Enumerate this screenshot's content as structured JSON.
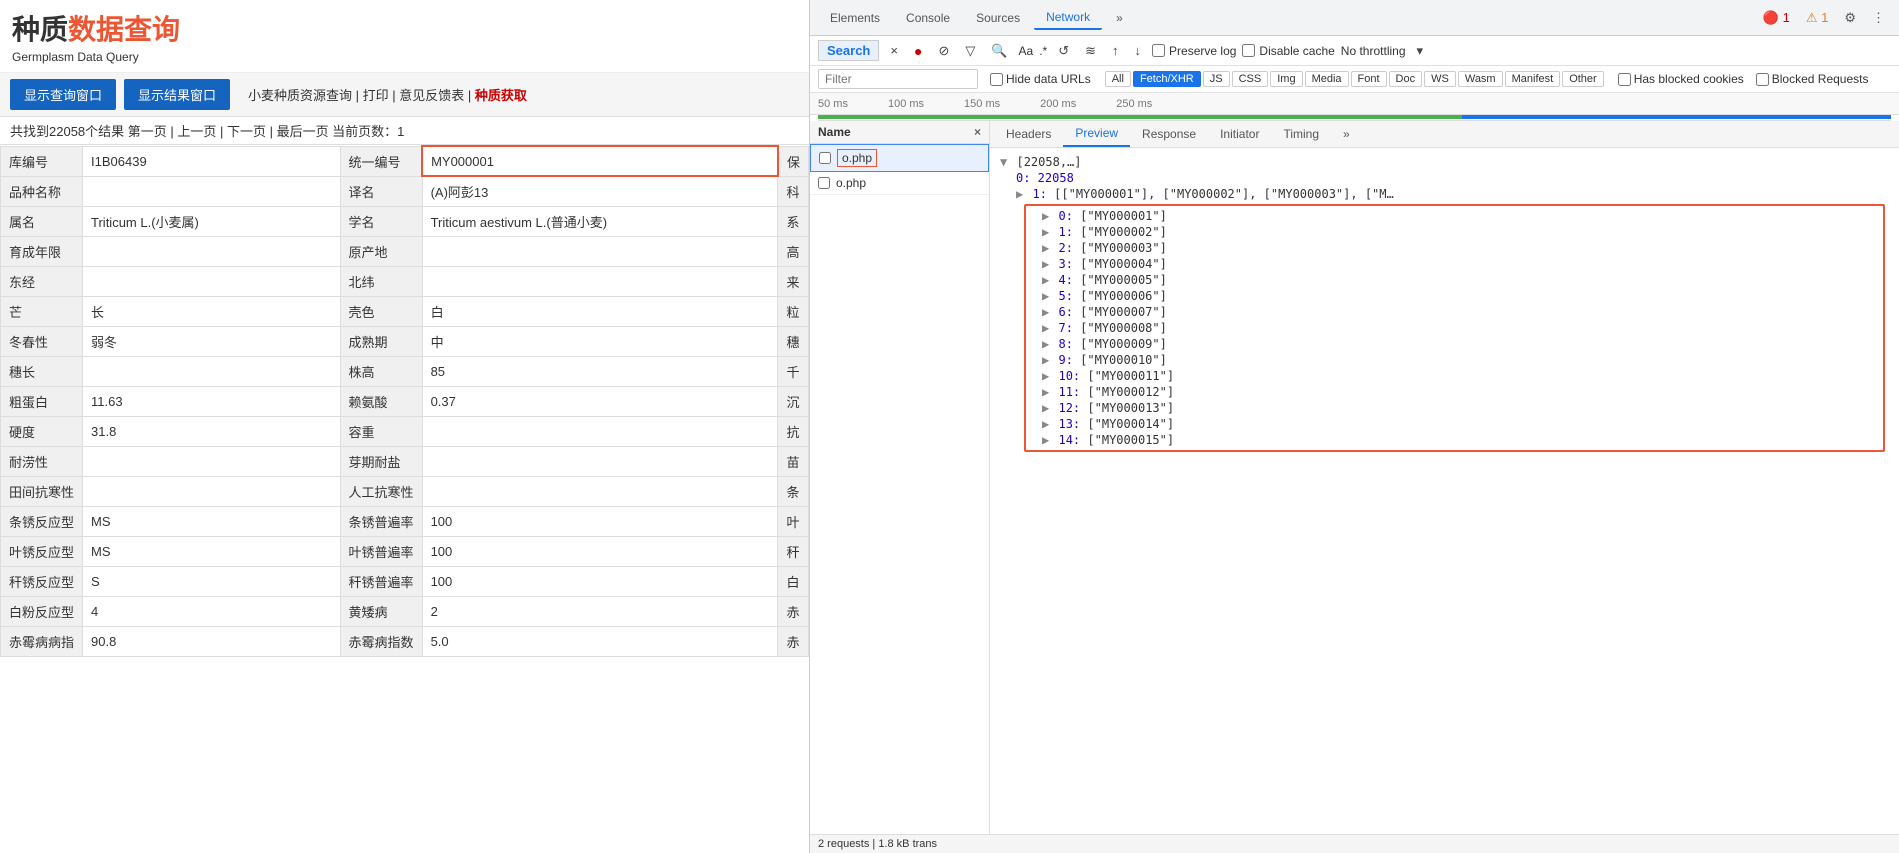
{
  "app": {
    "logo_zh1": "种质",
    "logo_zh2": "数据查询",
    "logo_subtitle": "Germplasm Data Query"
  },
  "toolbar": {
    "btn1": "显示查询窗口",
    "btn2": "显示结果窗口",
    "links_text": "小麦种质资源查询 | 打印 | 意见反馈表 |",
    "links_red": "种质获取"
  },
  "pagination": {
    "text": "共找到22058个结果  第一页 | 上一页 | 下一页 | 最后一页  当前页数：1"
  },
  "table_rows": [
    {
      "label1": "库编号",
      "val1": "I1B06439",
      "label2": "统一编号",
      "val2": "MY000001",
      "label3": "保",
      "val3": ""
    },
    {
      "label1": "品种名称",
      "val1": "",
      "label2": "译名",
      "val2": "(A)阿彭13",
      "label3": "科",
      "val3": ""
    },
    {
      "label1": "属名",
      "val1": "Triticum L.(小麦属)",
      "label2": "学名",
      "val2": "Triticum aestivum L.(普通小麦)",
      "label3": "系",
      "val3": ""
    },
    {
      "label1": "育成年限",
      "val1": "",
      "label2": "原产地",
      "val2": "",
      "label3": "高",
      "val3": ""
    },
    {
      "label1": "东经",
      "val1": "",
      "label2": "北纬",
      "val2": "",
      "label3": "来",
      "val3": ""
    },
    {
      "label1": "芒",
      "val1": "长",
      "label2": "壳色",
      "val2": "白",
      "label3": "粒",
      "val3": ""
    },
    {
      "label1": "冬春性",
      "val1": "弱冬",
      "label2": "成熟期",
      "val2": "中",
      "label3": "穗",
      "val3": ""
    },
    {
      "label1": "穗长",
      "val1": "",
      "label2": "株高",
      "val2": "85",
      "label3": "千",
      "val3": ""
    },
    {
      "label1": "粗蛋白",
      "val1": "11.63",
      "label2": "赖氨酸",
      "val2": "0.37",
      "label3": "沉",
      "val3": ""
    },
    {
      "label1": "硬度",
      "val1": "31.8",
      "label2": "容重",
      "val2": "",
      "label3": "抗",
      "val3": ""
    },
    {
      "label1": "耐涝性",
      "val1": "",
      "label2": "芽期耐盐",
      "val2": "",
      "label3": "苗",
      "val3": ""
    },
    {
      "label1": "田间抗寒性",
      "val1": "",
      "label2": "人工抗寒性",
      "val2": "",
      "label3": "条",
      "val3": ""
    },
    {
      "label1": "条锈反应型",
      "val1": "MS",
      "label2": "条锈普遍率",
      "val2": "100",
      "label3": "叶",
      "val3": ""
    },
    {
      "label1": "叶锈反应型",
      "val1": "MS",
      "label2": "叶锈普遍率",
      "val2": "100",
      "label3": "秆",
      "val3": ""
    },
    {
      "label1": "秆锈反应型",
      "val1": "S",
      "label2": "秆锈普遍率",
      "val2": "100",
      "label3": "白",
      "val3": ""
    },
    {
      "label1": "白粉反应型",
      "val1": "4",
      "label2": "黄矮病",
      "val2": "2",
      "label3": "赤",
      "val3": ""
    },
    {
      "label1": "赤霉病病指",
      "val1": "90.8",
      "label2": "赤霉病指数",
      "val2": "5.0",
      "label3": "赤",
      "val3": ""
    }
  ],
  "devtools": {
    "tabs": [
      "Elements",
      "Console",
      "Sources",
      "Network"
    ],
    "active_tab": "Network",
    "more_tabs": "»",
    "error_count": "1",
    "warn_count": "1",
    "settings_icon": "⚙",
    "more_icon": "⋮"
  },
  "network_toolbar": {
    "search_label": "Search",
    "search_close": "×",
    "record_btn": "●",
    "stop_btn": "🚫",
    "filter_btn": "▽",
    "search_icon": "🔍",
    "aa_label": "Aa",
    "dot_label": ".*",
    "refresh_icon": "↺",
    "preserve_log": "Preserve log",
    "disable_cache": "Disable cache",
    "no_throttling": "No throttling",
    "dropdown_icon": "▾",
    "wifi_icon": "📶",
    "up_icon": "↑",
    "down_icon": "↓"
  },
  "filter": {
    "placeholder": "Filter",
    "hide_data_urls": "Hide data URLs",
    "filter_types": [
      "All",
      "Fetch/XHR",
      "JS",
      "CSS",
      "Img",
      "Media",
      "Font",
      "Doc",
      "WS",
      "Wasm",
      "Manifest",
      "Other"
    ],
    "active_filter": "Fetch/XHR",
    "has_blocked": "Has blocked cookies",
    "blocked_requests": "Blocked Requests"
  },
  "timeline": {
    "marks": [
      "50 ms",
      "100 ms",
      "150 ms",
      "200 ms",
      "250 ms"
    ]
  },
  "network_list": {
    "header": "Name",
    "items": [
      {
        "name": "o.php",
        "selected": true
      },
      {
        "name": "o.php",
        "selected": false
      }
    ]
  },
  "detail_tabs": [
    "Headers",
    "Preview",
    "Response",
    "Initiator",
    "Timing",
    "»"
  ],
  "active_detail_tab": "Preview",
  "json_preview": {
    "root_label": "▼ [22058,…]",
    "item_0": "0: 22058",
    "item_1_label": "▶ 1: [[\"MY000001\"], [\"MY000002\"], [\"MY000003\"], [\"M…",
    "subitems": [
      {
        "arrow": "▶",
        "key": "0",
        "val": "[\"MY000001\"]"
      },
      {
        "arrow": "▶",
        "key": "1",
        "val": "[\"MY000002\"]"
      },
      {
        "arrow": "▶",
        "key": "2",
        "val": "[\"MY000003\"]"
      },
      {
        "arrow": "▶",
        "key": "3",
        "val": "[\"MY000004\"]"
      },
      {
        "arrow": "▶",
        "key": "4",
        "val": "[\"MY000005\"]"
      },
      {
        "arrow": "▶",
        "key": "5",
        "val": "[\"MY000006\"]"
      },
      {
        "arrow": "▶",
        "key": "6",
        "val": "[\"MY000007\"]"
      },
      {
        "arrow": "▶",
        "key": "7",
        "val": "[\"MY000008\"]"
      },
      {
        "arrow": "▶",
        "key": "8",
        "val": "[\"MY000009\"]"
      },
      {
        "arrow": "▶",
        "key": "9",
        "val": "[\"MY000010\"]"
      },
      {
        "arrow": "▶",
        "key": "10",
        "val": "[\"MY000011\"]"
      },
      {
        "arrow": "▶",
        "key": "11",
        "val": "[\"MY000012\"]"
      },
      {
        "arrow": "▶",
        "key": "12",
        "val": "[\"MY000013\"]"
      },
      {
        "arrow": "▶",
        "key": "13",
        "val": "[\"MY000014\"]"
      },
      {
        "arrow": "▶",
        "key": "14",
        "val": "[\"MY000015\"]"
      }
    ]
  },
  "status_bar": {
    "text": "2 requests | 1.8 kB trans"
  }
}
